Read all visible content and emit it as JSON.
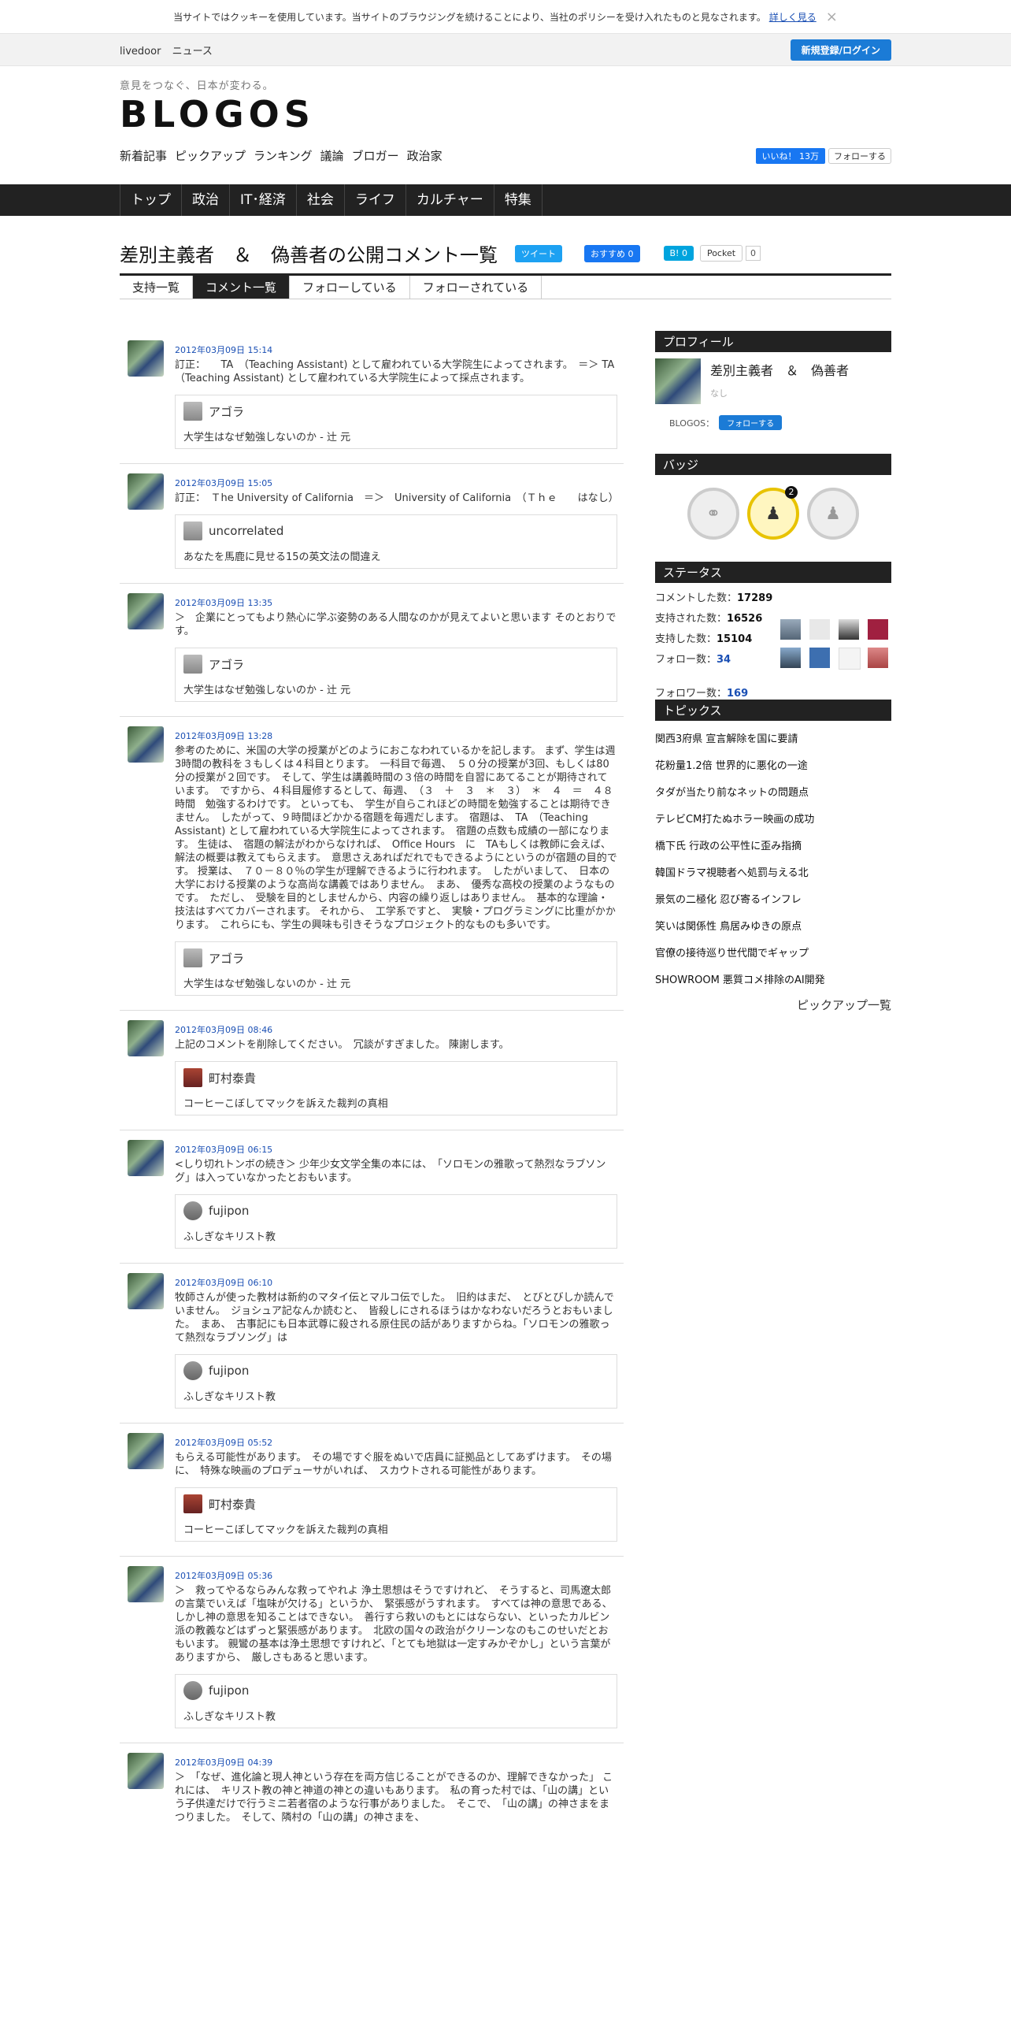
{
  "cookie": {
    "text": "当サイトではクッキーを使用しています。当サイトのブラウジングを続けることにより、当社のポリシーを受け入れたものと見なされます。",
    "more": "詳しく見る",
    "close": "×"
  },
  "topbar": {
    "livedoor": "livedoor",
    "news": "ニュース",
    "register": "新規登録/ログイン"
  },
  "header": {
    "tagline": "意見をつなぐ、日本が変わる。",
    "logo": "BLOGOS",
    "links": [
      "新着記事",
      "ピックアップ",
      "ランキング",
      "議論",
      "ブロガー",
      "政治家"
    ],
    "fb_like": "いいね！ 13万",
    "tw_follow": "フォローする"
  },
  "gnav": [
    "トップ",
    "政治",
    "IT･経済",
    "社会",
    "ライフ",
    "カルチャー",
    "特集"
  ],
  "page": {
    "title": "差別主義者　＆　偽善者の公開コメント一覧",
    "share": {
      "tweet": "ツイート",
      "fb": "おすすめ 0",
      "hatena": "B! 0",
      "pocket": "Pocket",
      "pocket_count": "0"
    }
  },
  "tabs": [
    "支持一覧",
    "コメント一覧",
    "フォローしている",
    "フォローされている"
  ],
  "comments": [
    {
      "date": "2012年03月09日 15:14",
      "text": "訂正：　　TA　（Teaching Assistant) として雇われている大学院生によってされます。　＝＞ TA　（Teaching Assistant) として雇われている大学院生によって採点されます。",
      "user": "アゴラ",
      "article": "大学生はなぜ勉強しないのか - 辻 元"
    },
    {
      "date": "2012年03月09日 15:05",
      "text": "訂正：　Ｔhe University of California　＝＞　University of California　（Ｔｈｅ　　はなし）",
      "user": "uncorrelated",
      "article": "あなたを馬鹿に見せる15の英文法の間違え"
    },
    {
      "date": "2012年03月09日 13:35",
      "text": "＞　企業にとってもより熱心に学ぶ姿勢のある人間なのかが見えてよいと思います そのとおりです。",
      "user": "アゴラ",
      "article": "大学生はなぜ勉強しないのか - 辻 元"
    },
    {
      "date": "2012年03月09日 13:28",
      "text": "参考のために、米国の大学の授業がどのようにおこなわれているかを記します。 まず、学生は週3時間の教科を３もしくは４科目とります。　一科目で毎週、　５０分の授業が3回、もしくは80分の授業が２回です。　そして、学生は講義時間の３倍の時間を自習にあてることが期待されています。　ですから、４科目履修するとして、毎週、　（３　＋　３　＊　３）　＊　４　＝　４８時間　勉強するわけです。 といっても、　学生が自らこれほどの時間を勉強することは期待できません。　したがって、９時間ほどかかる宿題を毎週だします。　宿題は、　TA　（Teaching Assistant) として雇われている大学院生によってされます。　宿題の点数も成績の一部になります。 生徒は、　宿題の解法がわからなければ、　Office Hours　に　TAもしくは教師に会えば、　解法の概要は教えてもらえます。　意思さえあればだれでもできるようにというのが宿題の目的です。 授業は、　７０－８０％の学生が理解できるように行われます。　したがいまして、　日本の大学における授業のような高尚な講義ではありません。　まあ、　優秀な高校の授業のようなものです。　ただし、　受験を目的としませんから、内容の繰り返しはありません。　基本的な理論・技法はすべてカバーされます。 それから、　工学系ですと、　実験・プログラミングに比重がかかります。　これらにも、学生の興味も引きそうなプロジェクト的なものも多いです。",
      "user": "アゴラ",
      "article": "大学生はなぜ勉強しないのか - 辻 元"
    },
    {
      "date": "2012年03月09日 08:46",
      "text": "上記のコメントを削除してください。　冗談がすぎました。 陳謝します。",
      "user": "町村泰貴",
      "article": "コーヒーこぼしてマックを訴えた裁判の真相"
    },
    {
      "date": "2012年03月09日 06:15",
      "text": "<しり切れトンボの続き＞ 少年少女文学全集の本には、　「ソロモンの雅歌って熱烈なラブソング」は入っていなかったとおもいます。",
      "user": "fujipon",
      "article": "ふしぎなキリスト教"
    },
    {
      "date": "2012年03月09日 06:10",
      "text": "牧師さんが使った教材は新約のマタイ伝とマルコ伝でした。　旧約はまだ、　とびとびしか読んでいません。　ジョシュア記なんか読むと、　皆殺しにされるほうはかなわないだろうとおもいました。　まあ、　古事記にも日本武尊に殺される原住民の話がありますからね。「ソロモンの雅歌って熱烈なラブソング」は",
      "user": "fujipon",
      "article": "ふしぎなキリスト教"
    },
    {
      "date": "2012年03月09日 05:52",
      "text": "もらえる可能性があります。　その場ですぐ服をぬいで店員に証拠品としてあずけます。　その場に、　特殊な映画のプロデューサがいれば、　スカウトされる可能性があります。",
      "user": "町村泰貴",
      "article": "コーヒーこぼしてマックを訴えた裁判の真相"
    },
    {
      "date": "2012年03月09日 05:36",
      "text": "＞　救ってやるならみんな救ってやれよ 浄土思想はそうですけれど、　そうすると、司馬遼太郎の言葉でいえば「塩味が欠ける」というか、　緊張感がうすれます。　すべては神の意思である、　しかし神の意思を知ることはできない。　善行すら救いのもとにはならない、といったカルビン派の教義などはずっと緊張感があります。　北欧の国々の政治がクリーンなのもこのせいだとおもいます。 親鸞の基本は浄土思想ですけれど、「とても地獄は一定すみかぞかし」という言葉がありますから、　厳しさもあると思います。",
      "user": "fujipon",
      "article": "ふしぎなキリスト教"
    },
    {
      "date": "2012年03月09日 04:39",
      "text": "＞　「なぜ、進化論と現人神という存在を両方信じることができるのか、理解できなかった」 これには、　キリスト教の神と神道の神との違いもあります。　私の育った村では、「山の講」という子供達だけで行うミニ若者宿のような行事がありました。　そこで、　「山の講」の神さまをまつりました。　そして、隣村の「山の講」の神さまを、",
      "user": "",
      "article": ""
    }
  ],
  "sidebar": {
    "profile": {
      "heading": "プロフィール",
      "name": "差別主義者　＆　偽善者",
      "desc": "なし",
      "blogos_label": "BLOGOS：",
      "follow": "フォローする"
    },
    "badges": {
      "heading": "バッジ",
      "count": "2"
    },
    "status": {
      "heading": "ステータス",
      "items": [
        {
          "label": "コメントした数：",
          "value": "17289"
        },
        {
          "label": "支持された数：",
          "value": "16526"
        },
        {
          "label": "支持した数：",
          "value": "15104"
        },
        {
          "label": "フォロー数：",
          "value": "34"
        },
        {
          "label": "フォロワー数：",
          "value": "169"
        }
      ]
    },
    "topics": {
      "heading": "トピックス",
      "items": [
        "関西3府県 宣言解除を国に要請",
        "花粉量1.2倍 世界的に悪化の一途",
        "タダが当たり前なネットの問題点",
        "テレビCM打たぬホラー映画の成功",
        "橋下氏 行政の公平性に歪み指摘",
        "韓国ドラマ視聴者へ処罰与える北",
        "景気の二極化 忍び寄るインフレ",
        "笑いは関係性 鳥居みゆきの原点",
        "官僚の接待巡り世代間でギャップ",
        "SHOWROOM 悪質コメ排除のAI開発"
      ],
      "more": "ピックアップ一覧"
    }
  },
  "colors": {
    "accent": "#1b7bd6",
    "nav": "#222222",
    "link": "#1a4fb4"
  }
}
